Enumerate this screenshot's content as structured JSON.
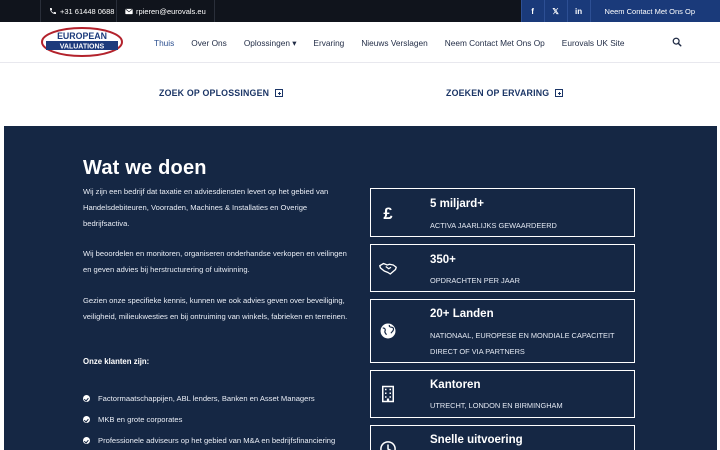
{
  "topbar": {
    "phone": "+31 61448 0688",
    "email": "rpieren@eurovals.eu",
    "social": [
      {
        "icon": "facebook-icon",
        "label": "f"
      },
      {
        "icon": "x-icon",
        "label": "𝕏"
      },
      {
        "icon": "linkedin-icon",
        "label": "in"
      }
    ],
    "cta": "Neem Contact Met Ons Op"
  },
  "logo": {
    "line1": "EUROPEAN",
    "line2": "VALUATIONS"
  },
  "nav": {
    "items": [
      {
        "label": "Thuis",
        "active": true
      },
      {
        "label": "Over Ons"
      },
      {
        "label": "Oplossingen ▾"
      },
      {
        "label": "Ervaring"
      },
      {
        "label": "Nieuws Verslagen"
      },
      {
        "label": "Neem Contact Met Ons Op"
      },
      {
        "label": "Eurovals UK Site"
      }
    ]
  },
  "links": {
    "solutions": "ZOEK OP OPLOSSINGEN",
    "experience": "ZOEKEN OP ERVARING"
  },
  "what": {
    "title": "Wat we doen",
    "p1": "Wij zijn een bedrijf dat taxatie en adviesdiensten levert op het gebied van Handelsdebiteuren, Voorraden, Machines & Installaties en Overige bedrijfsactiva.",
    "p2": "Wij beoordelen en monitoren, organiseren onderhandse verkopen en veilingen en geven advies bij herstructurering of uitwinning.",
    "p3": "Gezien onze specifieke kennis, kunnen we ook advies geven over beveiliging, veiligheid, milieukwesties en bij ontruiming van winkels, fabrieken en terreinen.",
    "clients_title": "Onze klanten zijn:",
    "clients": [
      "Factormaatschappijen, ABL lenders, Banken en Asset Managers",
      "MKB en grote corporates",
      "Professionele adviseurs op het gebied van M&A en bedrijfsfinanciering"
    ]
  },
  "stats": [
    {
      "icon": "pound-icon",
      "value": "5 miljard+",
      "desc": "ACTIVA JAARLIJKS GEWAARDEERD"
    },
    {
      "icon": "handshake-icon",
      "value": "350+",
      "desc": "OPDRACHTEN PER JAAR"
    },
    {
      "icon": "globe-icon",
      "value": "20+ Landen",
      "desc": "NATIONAAL, EUROPESE EN MONDIALE CAPACITEIT DIRECT OF VIA PARTNERS"
    },
    {
      "icon": "building-icon",
      "value": "Kantoren",
      "desc": "UTRECHT, LONDON EN BIRMINGHAM"
    },
    {
      "icon": "clock-icon",
      "value": "Snelle uitvoering",
      "desc": ""
    }
  ],
  "colors": {
    "navy": "#152744",
    "topbar": "#10141c",
    "social": "#1a3a7a",
    "link": "#1b3566"
  }
}
